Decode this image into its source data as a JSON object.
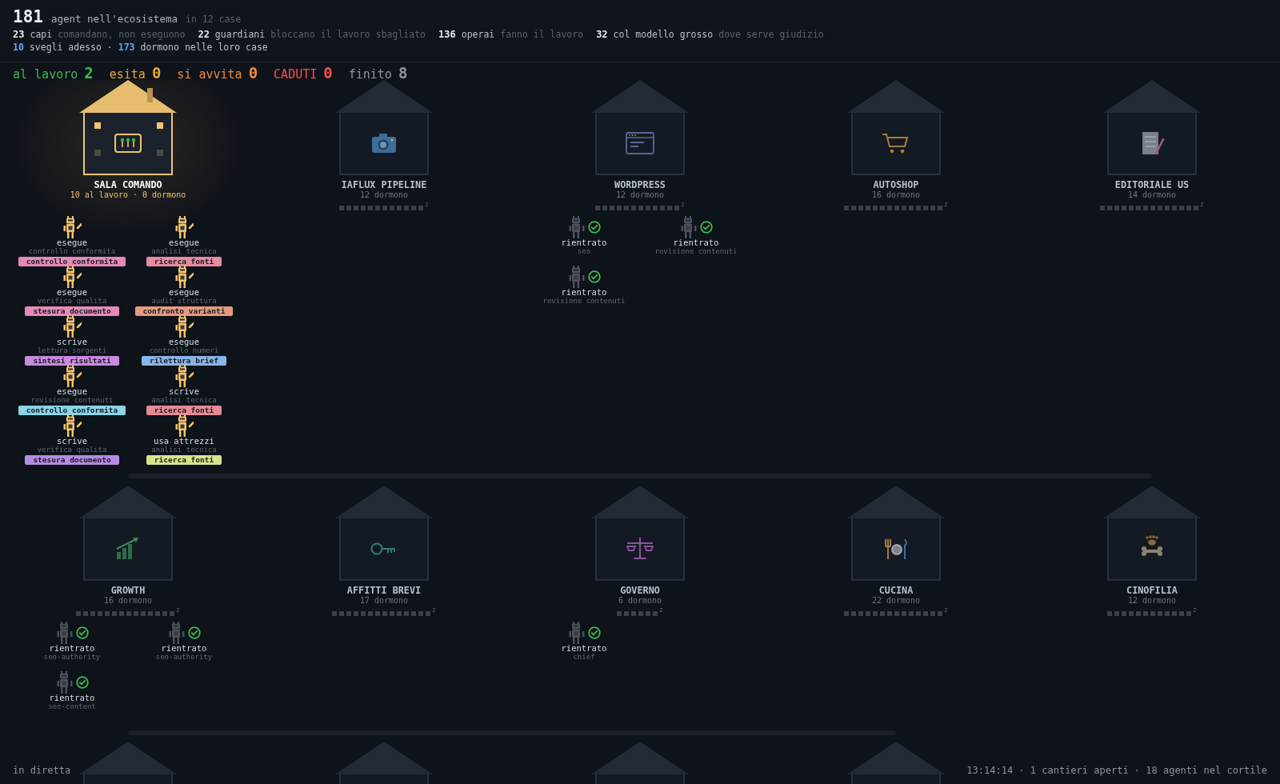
{
  "header": {
    "total": "181",
    "title": "agent nell'ecosistema",
    "subtitle": "in 12 case",
    "roles": [
      {
        "count": "23",
        "label": "capi",
        "desc": "comandano, non eseguono"
      },
      {
        "count": "22",
        "label": "guardiani",
        "desc": "bloccano il lavoro sbagliato"
      },
      {
        "count": "136",
        "label": "operai",
        "desc": "fanno il lavoro"
      },
      {
        "count": "32",
        "label": "col modello grosso",
        "desc": "dove serve giudizio"
      }
    ],
    "presence": [
      {
        "count": "10",
        "label": "svegli adesso ·"
      },
      {
        "count": "173",
        "label": "dormono nelle loro case"
      }
    ]
  },
  "status": [
    {
      "label": "al lavoro",
      "count": "2",
      "color": "#3fb950"
    },
    {
      "label": "esita",
      "count": "0",
      "color": "#e3a536"
    },
    {
      "label": "si avvita",
      "count": "0",
      "color": "#f0883e"
    },
    {
      "label": "CADUTI",
      "count": "0",
      "color": "#f85149"
    },
    {
      "label": "finito",
      "count": "8",
      "color": "#8b949e"
    }
  ],
  "rows": [
    {
      "houses": [
        {
          "kind": "control-panel",
          "name": "SALA COMANDO",
          "sub": "10 al lavoro · 0 dormono",
          "active": true,
          "agents": [
            {
              "kind": "working",
              "status": "esegue",
              "task": "controllo conformita",
              "chip": "controllo conformita",
              "color": "#e58ab8"
            },
            {
              "kind": "working",
              "status": "esegue",
              "task": "analisi tecnica",
              "chip": "ricerca fonti",
              "color": "#e68aa0"
            },
            {
              "kind": "working",
              "status": "esegue",
              "task": "verifica qualita",
              "chip": "stesura documento",
              "color": "#e58ab8"
            },
            {
              "kind": "working",
              "status": "esegue",
              "task": "audit struttura",
              "chip": "confronto varianti",
              "color": "#e39a80"
            },
            {
              "kind": "working",
              "status": "scrive",
              "task": "lettura sorgenti",
              "chip": "sintesi risultati",
              "color": "#c98ae0"
            },
            {
              "kind": "working",
              "status": "esegue",
              "task": "controllo numeri",
              "chip": "rilettura brief",
              "color": "#8ab4e6"
            },
            {
              "kind": "working",
              "status": "esegue",
              "task": "revisione contenuti",
              "chip": "controllo conformita",
              "color": "#8ad4e6"
            },
            {
              "kind": "working",
              "status": "scrive",
              "task": "analisi tecnica",
              "chip": "ricerca fonti",
              "color": "#e68a95"
            },
            {
              "kind": "working",
              "status": "scrive",
              "task": "verifica qualita",
              "chip": "stesura documento",
              "color": "#b58ae6"
            },
            {
              "kind": "working",
              "status": "usa attrezzi",
              "task": "analisi tecnica",
              "chip": "ricerca fonti",
              "color": "#d6e68a"
            }
          ]
        },
        {
          "kind": "camera",
          "name": "IAFLUX PIPELINE",
          "sub": "12 dormono",
          "active": false,
          "sleep_mark": "z"
        },
        {
          "kind": "browser",
          "name": "WORDPRESS",
          "sub": "12 dormono",
          "active": false,
          "sleep_mark": "z",
          "agents": [
            {
              "kind": "returned",
              "status": "rientrato",
              "task": "seo"
            },
            {
              "kind": "returned",
              "status": "rientrato",
              "task": "revisione contenuti"
            },
            {
              "kind": "returned",
              "status": "rientrato",
              "task": "revisione contenuti"
            }
          ]
        },
        {
          "kind": "cart",
          "name": "AUTOSHOP",
          "sub": "16 dormono",
          "active": false,
          "sleep_mark": "z"
        },
        {
          "kind": "document",
          "name": "EDITORIALE US",
          "sub": "14 dormono",
          "active": false,
          "sleep_mark": "z"
        }
      ]
    },
    {
      "houses": [
        {
          "kind": "chart",
          "name": "GROWTH",
          "sub": "16 dormono",
          "active": false,
          "sleep_mark": "z",
          "agents": [
            {
              "kind": "returned",
              "status": "rientrato",
              "task": "seo-authority"
            },
            {
              "kind": "returned",
              "status": "rientrato",
              "task": "seo-authority"
            },
            {
              "kind": "returned",
              "status": "rientrato",
              "task": "seo-content"
            }
          ]
        },
        {
          "kind": "key",
          "name": "AFFITTI BREVI",
          "sub": "17 dormono",
          "active": false,
          "sleep_mark": "z"
        },
        {
          "kind": "scales",
          "name": "GOVERNO",
          "sub": "6 dormono",
          "active": false,
          "sleep_mark": "z",
          "agents": [
            {
              "kind": "returned",
              "status": "rientrato",
              "task": "chief"
            }
          ]
        },
        {
          "kind": "dinner",
          "name": "CUCINA",
          "sub": "22 dormono",
          "active": false,
          "sleep_mark": "z"
        },
        {
          "kind": "bone",
          "name": "CINOFILIA",
          "sub": "12 dormono",
          "active": false,
          "sleep_mark": "z"
        }
      ]
    },
    {
      "houses": [
        {
          "kind": "stub"
        },
        {
          "kind": "stub"
        },
        {
          "kind": "stub"
        },
        {
          "kind": "stub"
        }
      ]
    }
  ],
  "footer": {
    "left": "in diretta",
    "right": "13:14:14 · 1 cantieri aperti · 18 agenti nel cortile"
  }
}
